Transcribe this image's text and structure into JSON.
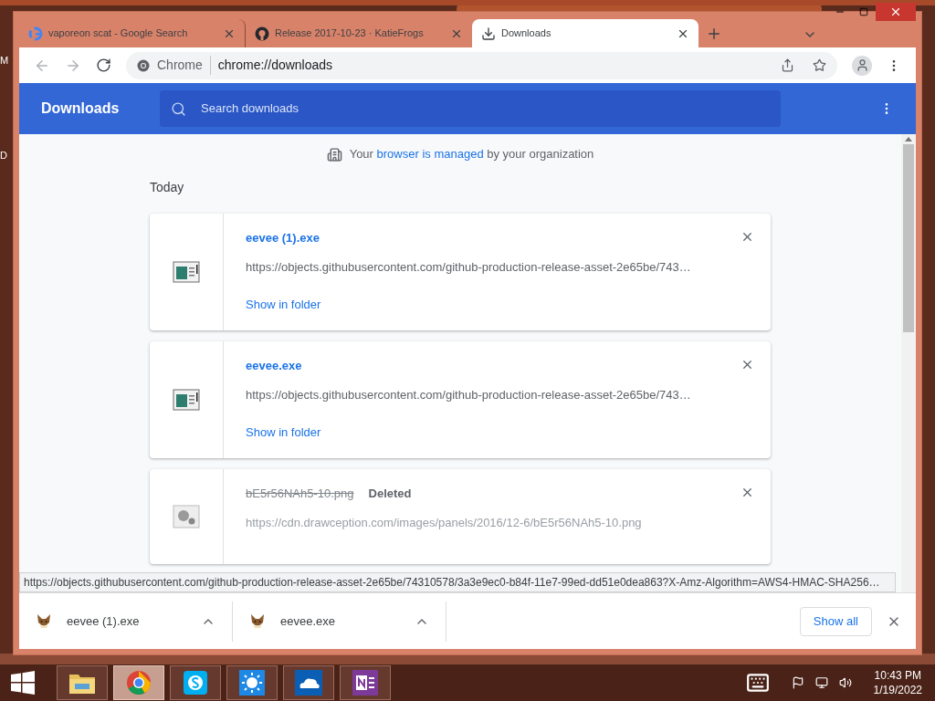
{
  "desktop": {
    "edge_labels": [
      "M",
      "D"
    ]
  },
  "tabs": [
    {
      "title": "vaporeon scat - Google Search",
      "kind": "google",
      "selected": false
    },
    {
      "title": "Release 2017-10-23 · KatieFrogs",
      "kind": "github",
      "selected": false
    },
    {
      "title": "Downloads",
      "kind": "download",
      "selected": true
    }
  ],
  "address_bar": {
    "site_label": "Chrome",
    "url": "chrome://downloads"
  },
  "page": {
    "title": "Downloads",
    "search": {
      "placeholder": "Search downloads"
    },
    "managed_notice": {
      "before": "Your",
      "link": "browser is managed",
      "after": "by your organization"
    },
    "section": "Today",
    "downloads": [
      {
        "name": "eevee (1).exe",
        "url": "https://objects.githubusercontent.com/github-production-release-asset-2e65be/743…",
        "action": "Show in folder",
        "deleted": false
      },
      {
        "name": "eevee.exe",
        "url": "https://objects.githubusercontent.com/github-production-release-asset-2e65be/743…",
        "action": "Show in folder",
        "deleted": false
      },
      {
        "name": "bE5r56NAh5-10.png",
        "url": "https://cdn.drawception.com/images/panels/2016/12-6/bE5r56NAh5-10.png",
        "status": "Deleted",
        "deleted": true
      }
    ]
  },
  "status_url": "https://objects.githubusercontent.com/github-production-release-asset-2e65be/74310578/3a3e9ec0-b84f-11e7-99ed-dd51e0dea863?X-Amz-Algorithm=AWS4-HMAC-SHA256…",
  "shelf": {
    "items": [
      {
        "name": "eevee (1).exe"
      },
      {
        "name": "eevee.exe"
      }
    ],
    "show_all": "Show all"
  },
  "taskbar": {
    "apps": [
      {
        "kind": "explorer",
        "selected": false
      },
      {
        "kind": "chrome",
        "selected": true
      },
      {
        "kind": "skype",
        "selected": false
      },
      {
        "kind": "weather",
        "selected": false
      },
      {
        "kind": "onedrive",
        "selected": false
      },
      {
        "kind": "onenote",
        "selected": false
      }
    ],
    "time": "10:43 PM",
    "date": "1/19/2022"
  }
}
